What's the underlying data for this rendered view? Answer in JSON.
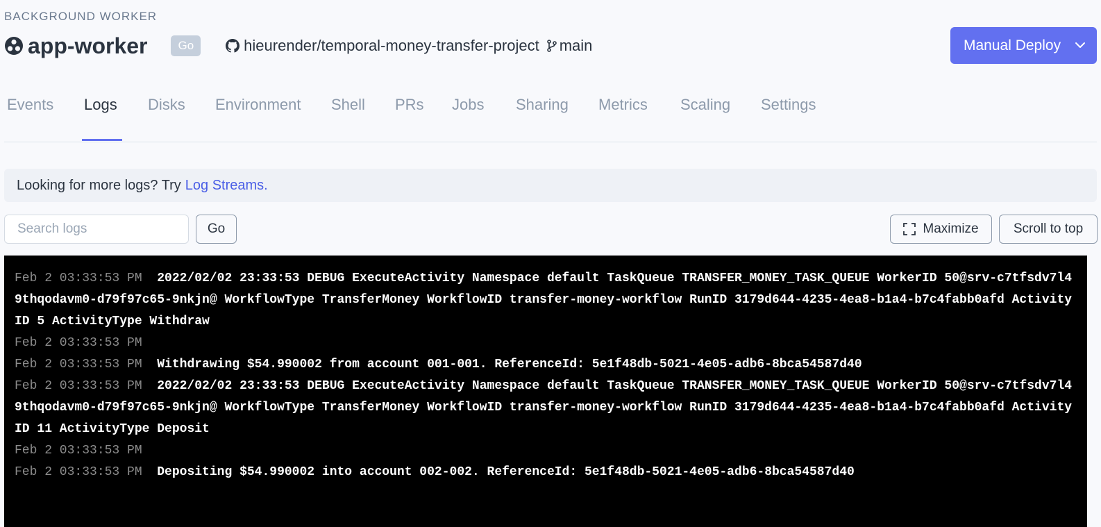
{
  "header": {
    "service_type": "BACKGROUND WORKER",
    "service_name": "app-worker",
    "language_badge": "Go",
    "repo": "hieurender/temporal-money-transfer-project",
    "branch": "main",
    "deploy_button": "Manual Deploy",
    "accent_color": "#6270f0"
  },
  "tabs": [
    {
      "label": "Events",
      "active": false
    },
    {
      "label": "Logs",
      "active": true
    },
    {
      "label": "Disks",
      "active": false
    },
    {
      "label": "Environment",
      "active": false
    },
    {
      "label": "Shell",
      "active": false
    },
    {
      "label": "PRs",
      "active": false
    },
    {
      "label": "Jobs",
      "active": false
    },
    {
      "label": "Sharing",
      "active": false
    },
    {
      "label": "Metrics",
      "active": false
    },
    {
      "label": "Scaling",
      "active": false
    },
    {
      "label": "Settings",
      "active": false
    }
  ],
  "notice": {
    "text": "Looking for more logs? Try",
    "link": "Log Streams."
  },
  "search": {
    "placeholder": "Search logs",
    "go_label": "Go"
  },
  "toolbar": {
    "maximize_label": "Maximize",
    "scroll_top_label": "Scroll to top"
  },
  "logs": [
    {
      "ts": "Feb 2 03:33:53 PM",
      "msg": "2022/02/02 23:33:53 DEBUG ExecuteActivity Namespace default TaskQueue TRANSFER_MONEY_TASK_QUEUE WorkerID 50@srv-c7tfsdv7l49thqodavm0-d79f97c65-9nkjn@ WorkflowType TransferMoney WorkflowID transfer-money-workflow RunID 3179d644-4235-4ea8-b1a4-b7c4fabb0afd ActivityID 5 ActivityType Withdraw"
    },
    {
      "ts": "Feb 2 03:33:53 PM",
      "msg": ""
    },
    {
      "ts": "Feb 2 03:33:53 PM",
      "msg": "Withdrawing $54.990002 from account 001-001. ReferenceId: 5e1f48db-5021-4e05-adb6-8bca54587d40"
    },
    {
      "ts": "Feb 2 03:33:53 PM",
      "msg": "2022/02/02 23:33:53 DEBUG ExecuteActivity Namespace default TaskQueue TRANSFER_MONEY_TASK_QUEUE WorkerID 50@srv-c7tfsdv7l49thqodavm0-d79f97c65-9nkjn@ WorkflowType TransferMoney WorkflowID transfer-money-workflow RunID 3179d644-4235-4ea8-b1a4-b7c4fabb0afd ActivityID 11 ActivityType Deposit"
    },
    {
      "ts": "Feb 2 03:33:53 PM",
      "msg": ""
    },
    {
      "ts": "Feb 2 03:33:53 PM",
      "msg": "Depositing $54.990002 into account 002-002. ReferenceId: 5e1f48db-5021-4e05-adb6-8bca54587d40"
    }
  ]
}
